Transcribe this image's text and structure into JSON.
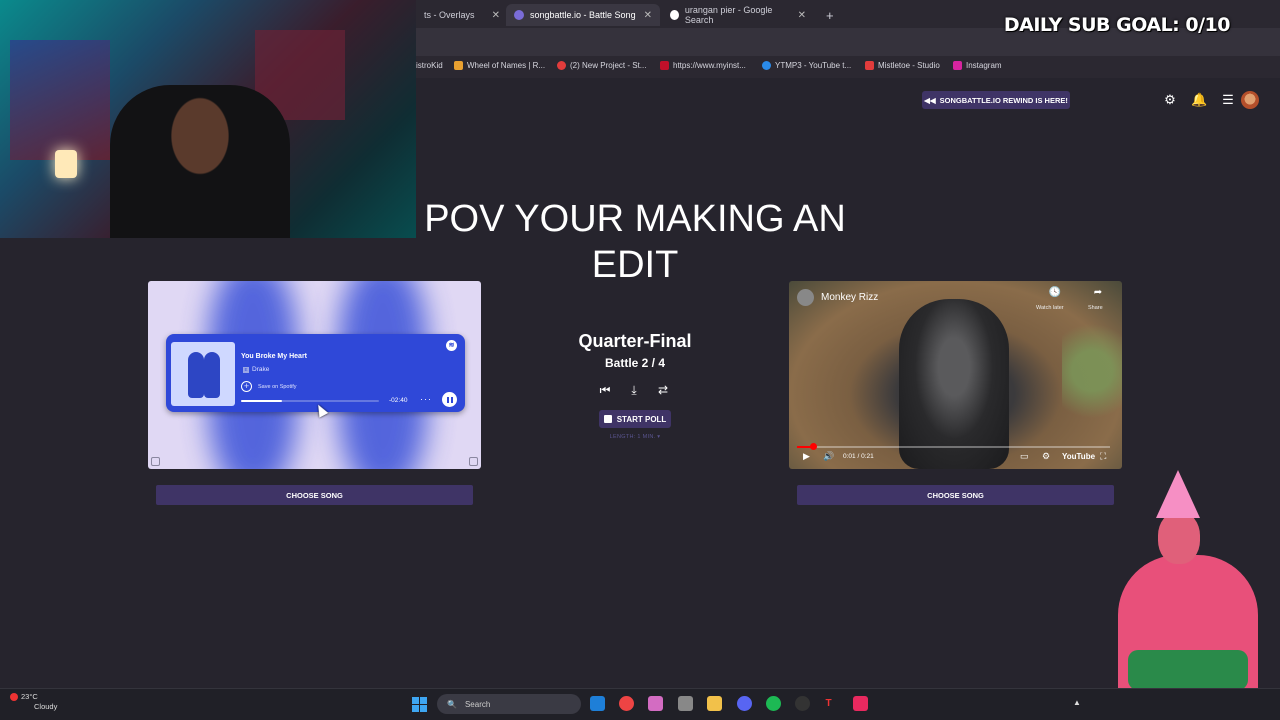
{
  "browser": {
    "tabs": [
      {
        "label": "ts - Overlays",
        "active": false
      },
      {
        "label": "songbattle.io - Battle Song",
        "active": true
      },
      {
        "label": "urangan pier - Google Search",
        "active": false
      }
    ],
    "new_tab": "+",
    "tab_close": "✕",
    "bookmarks": [
      "istroKid",
      "Wheel of Names | R...",
      "(2) New Project - St...",
      "https://www.myinst...",
      "YTMP3 - YouTube t...",
      "Mistletoe - Studio",
      "Instagram"
    ]
  },
  "overlay": {
    "sub_goal": "DAILY SUB GOAL: 0/10"
  },
  "site": {
    "rewind_label": "SONGBATTLE.IO REWIND IS HERE!",
    "icons": [
      "settings-icon",
      "bell-icon",
      "menu-icon"
    ],
    "title": "POV YOUR MAKING AN EDIT"
  },
  "left_song": {
    "name": "You Broke My Heart",
    "explicit": "E",
    "artist": "Drake",
    "save_label": "Save on Spotify",
    "time_remaining": "-02:40",
    "more": "···",
    "progress": 0.3,
    "choose_label": "CHOOSE SONG"
  },
  "battle": {
    "stage": "Quarter-Final",
    "battle_label": "Battle 2 / 4",
    "start_poll": "START POLL",
    "length": "LENGTH: 1 MIN. ▾"
  },
  "right_song": {
    "title": "Monkey Rizz",
    "watch_later": "Watch later",
    "share": "Share",
    "time": "0:01 / 0:21",
    "logo": "YouTube",
    "progress": 0.05,
    "choose_label": "CHOOSE SONG"
  },
  "taskbar": {
    "temp": "23°C",
    "condition": "Cloudy",
    "search_placeholder": "Search"
  },
  "colors": {
    "page_bg": "#26242d",
    "accent_button": "#3f3466",
    "spotify_card": "#2f48d8",
    "youtube_red": "#ff0000"
  }
}
